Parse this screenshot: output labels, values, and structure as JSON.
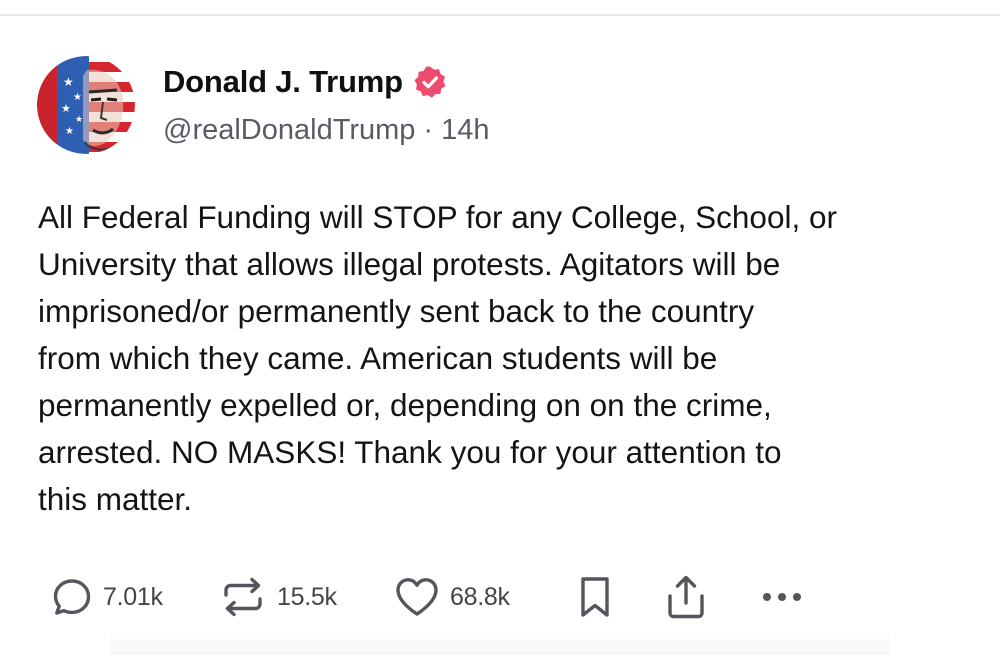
{
  "post": {
    "author": {
      "display_name": "Donald J. Trump",
      "verified_icon": "verified-badge-icon",
      "handle": "@realDonaldTrump",
      "separator": "·",
      "time_ago": "14h",
      "avatar_icon": "avatar-flag-portrait"
    },
    "text": "All Federal Funding will STOP for any College, School, or\nUniversity that allows illegal protests. Agitators will be\nimprisoned/or permanently sent back to the country\nfrom which they came. American students will be\npermanently expelled or, depending on on the crime,\narrested. NO MASKS! Thank you for your attention to\nthis matter."
  },
  "actions": {
    "reply": {
      "icon": "reply-bubble-icon",
      "count": "7.01k"
    },
    "repost": {
      "icon": "repost-arrows-icon",
      "count": "15.5k"
    },
    "like": {
      "icon": "heart-icon",
      "count": "68.8k"
    },
    "bookmark": {
      "icon": "bookmark-icon"
    },
    "share": {
      "icon": "share-icon"
    },
    "more": {
      "icon": "more-dots-icon"
    }
  },
  "colors": {
    "verified": "#ee4c6e",
    "text": "#141414",
    "secondary": "#5b5b66",
    "icon": "#55555e"
  }
}
